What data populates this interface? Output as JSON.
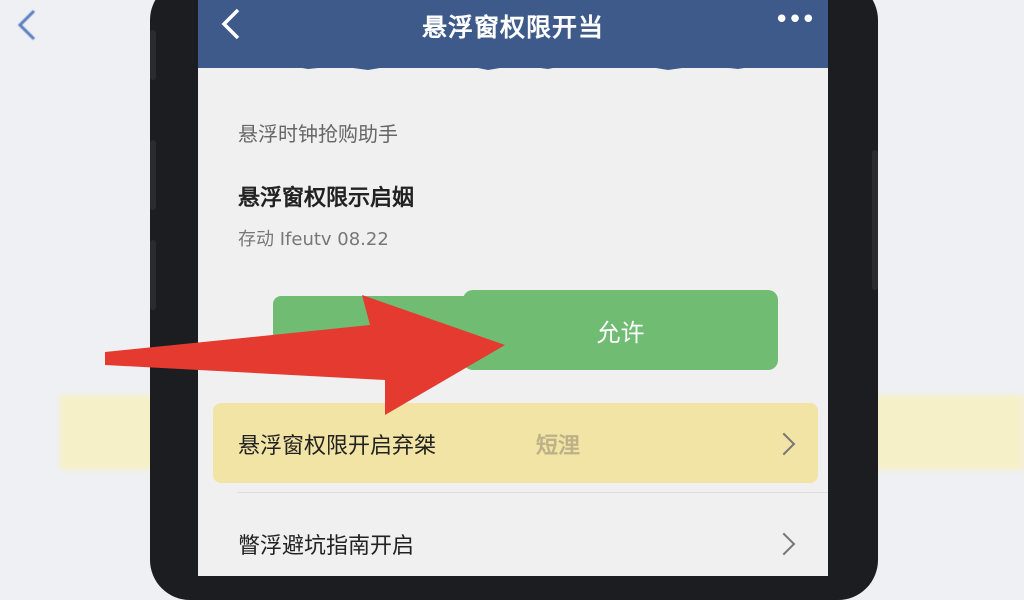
{
  "page": {
    "title": "悬浮窗权限开当",
    "more_icon": "more-icon",
    "section_label": "悬浮时钟抢购助手",
    "permission_title": "悬浮窗权限示启姻",
    "permission_subtitle": "存动 Ifeutv 08.22",
    "allow_button_label": "允许",
    "rows": [
      {
        "label": "悬浮窗权限开启弃桀",
        "mid": "短浬"
      },
      {
        "label": "瞥浮避坑指南开启"
      }
    ]
  },
  "colors": {
    "topbar": "#3e5a8a",
    "allow_green": "#6fbc72",
    "highlight_yellow": "#f1e3a0",
    "arrow_red": "#e53a2f"
  }
}
